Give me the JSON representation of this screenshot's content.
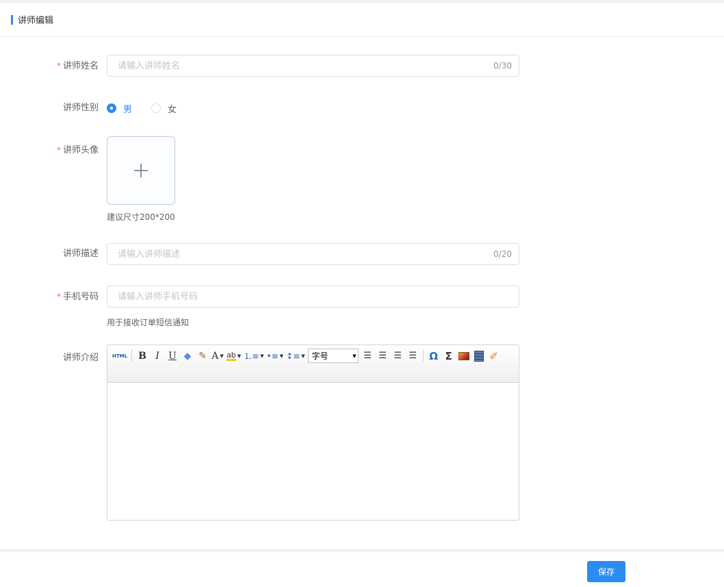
{
  "header": {
    "title": "讲师编辑"
  },
  "form": {
    "name": {
      "label": "讲师姓名",
      "required": "*",
      "placeholder": "请输入讲师姓名",
      "value": "",
      "count": "0/30"
    },
    "gender": {
      "label": "讲师性别",
      "options": [
        {
          "label": "男",
          "checked": true
        },
        {
          "label": "女",
          "checked": false
        }
      ]
    },
    "avatar": {
      "label": "讲师头像",
      "required": "*",
      "hint": "建议尺寸200*200"
    },
    "description": {
      "label": "讲师描述",
      "placeholder": "请输入讲师描述",
      "value": "",
      "count": "0/20"
    },
    "phone": {
      "label": "手机号码",
      "required": "*",
      "placeholder": "请输入讲师手机号码",
      "value": "",
      "hint": "用于接收订单短信通知"
    },
    "intro": {
      "label": "讲师介绍",
      "toolbar": {
        "html": "HTML",
        "bold": "B",
        "italic": "I",
        "underline": "U",
        "font_color": "A",
        "bg_color": "ab",
        "font_size_placeholder": "字号",
        "omega": "Ω",
        "sigma": "Σ"
      }
    }
  },
  "footer": {
    "save_label": "保存"
  },
  "colors": {
    "primary": "#2d8cf0",
    "required": "#f56c6c"
  }
}
